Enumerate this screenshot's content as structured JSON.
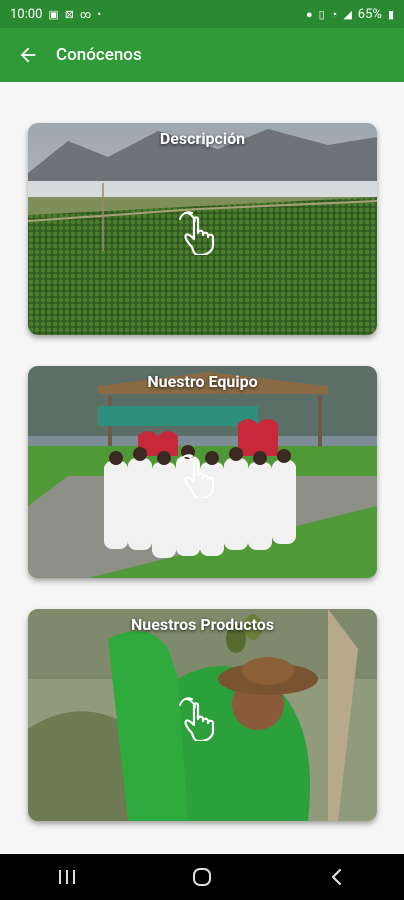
{
  "status_bar": {
    "time": "10:00",
    "battery": "65%"
  },
  "app_bar": {
    "title": "Conócenos",
    "back_icon": "arrow-left-icon"
  },
  "cards": [
    {
      "label": "Descripción",
      "image": "aerial-farm-landscape",
      "icon": "tap-hand-icon"
    },
    {
      "label": "Nuestro Equipo",
      "image": "team-group-photo",
      "icon": "tap-hand-icon"
    },
    {
      "label": "Nuestros Productos",
      "image": "worker-picking-fruit",
      "icon": "tap-hand-icon"
    }
  ],
  "colors": {
    "status_bar": "#2a8a32",
    "app_bar": "#2f9a37",
    "background": "#f6f6f6",
    "nav_bar": "#000000"
  },
  "nav_bar": {
    "items": [
      "recent-apps-icon",
      "home-icon",
      "back-icon"
    ]
  }
}
